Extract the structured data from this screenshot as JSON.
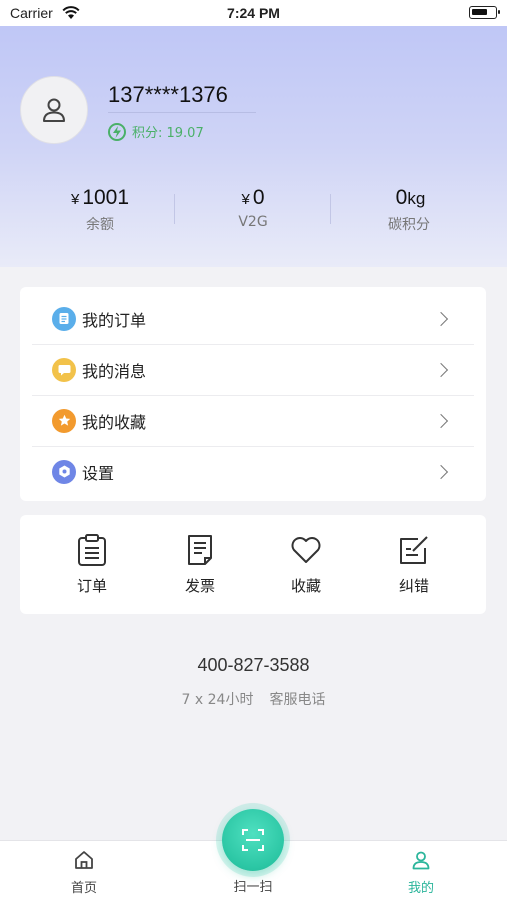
{
  "status_bar": {
    "carrier": "Carrier",
    "time": "7:24 PM"
  },
  "profile": {
    "phone": "137****1376",
    "points_label": "积分: 19.07"
  },
  "stats": [
    {
      "currency": "¥",
      "value": "1001",
      "unit": "",
      "label": "余额"
    },
    {
      "currency": "¥",
      "value": "0",
      "unit": "",
      "label": "V2G"
    },
    {
      "currency": "",
      "value": "0",
      "unit": "kg",
      "label": "碳积分"
    }
  ],
  "menu": [
    {
      "label": "我的订单",
      "icon": "order-icon",
      "color": "#5aaeea"
    },
    {
      "label": "我的消息",
      "icon": "message-icon",
      "color": "#f2c24a"
    },
    {
      "label": "我的收藏",
      "icon": "star-icon",
      "color": "#f29a2e"
    },
    {
      "label": "设置",
      "icon": "settings-icon",
      "color": "#6f86e6"
    }
  ],
  "quick_actions": [
    {
      "label": "订单",
      "icon": "clipboard-icon"
    },
    {
      "label": "发票",
      "icon": "invoice-icon"
    },
    {
      "label": "收藏",
      "icon": "heart-icon"
    },
    {
      "label": "纠错",
      "icon": "edit-icon"
    }
  ],
  "service": {
    "phone": "400-827-3588",
    "hours": "7 x 24小时",
    "label": "客服电话"
  },
  "tabbar": {
    "home": "首页",
    "scan": "扫一扫",
    "mine": "我的",
    "active_color": "#2bb59b"
  }
}
